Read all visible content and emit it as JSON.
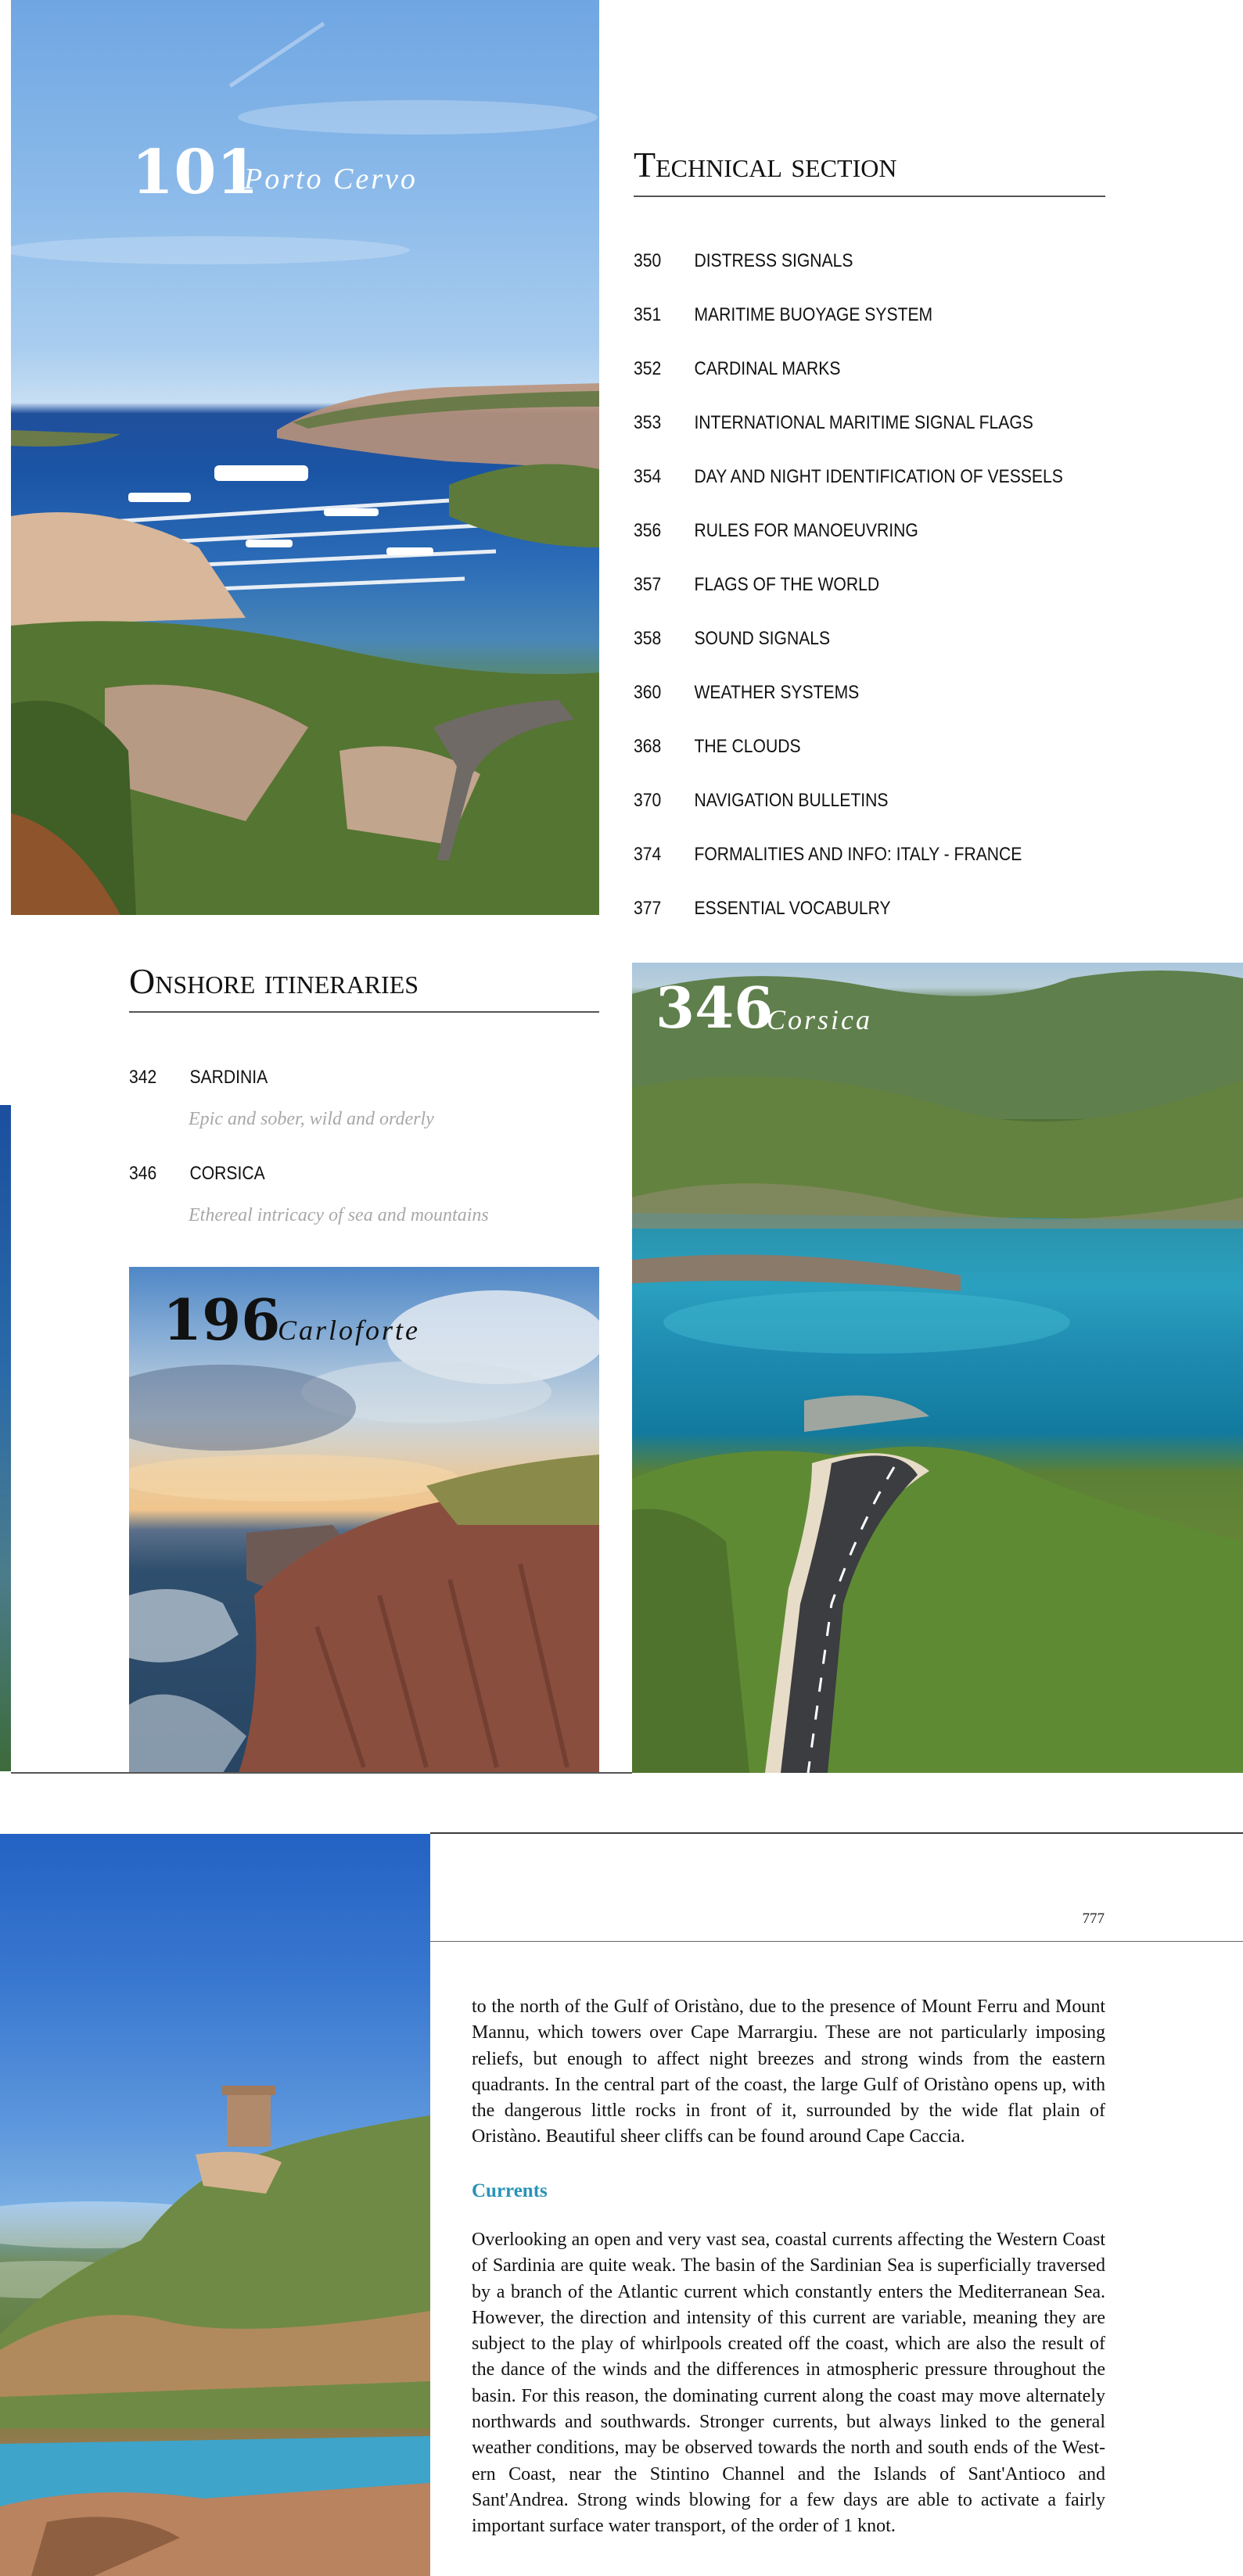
{
  "porto_cervo": {
    "number": "101",
    "place": "Porto Cervo"
  },
  "technical": {
    "title": "Technical section",
    "items": [
      {
        "num": "350",
        "label": "DISTRESS SIGNALS"
      },
      {
        "num": "351",
        "label": "MARITIME BUOYAGE SYSTEM"
      },
      {
        "num": "352",
        "label": "CARDINAL MARKS"
      },
      {
        "num": "353",
        "label": "INTERNATIONAL MARITIME SIGNAL FLAGS"
      },
      {
        "num": "354",
        "label": "DAY AND NIGHT IDENTIFICATION OF VESSELS"
      },
      {
        "num": "356",
        "label": "RULES FOR MANOEUVRING"
      },
      {
        "num": "357",
        "label": "FLAGS OF THE WORLD"
      },
      {
        "num": "358",
        "label": "SOUND SIGNALS"
      },
      {
        "num": "360",
        "label": "WEATHER SYSTEMS"
      },
      {
        "num": "368",
        "label": "THE CLOUDS"
      },
      {
        "num": "370",
        "label": "NAVIGATION BULLETINS"
      },
      {
        "num": "374",
        "label": "FORMALITIES AND INFO: ITALY - FRANCE"
      },
      {
        "num": "377",
        "label": "ESSENTIAL VOCABULRY"
      }
    ]
  },
  "onshore": {
    "title": "Onshore itineraries",
    "items": [
      {
        "num": "342",
        "label": "SARDINIA",
        "subtitle": "Epic and sober, wild and orderly"
      },
      {
        "num": "346",
        "label": "CORSICA",
        "subtitle": "Ethereal intricacy of sea and mountains"
      }
    ]
  },
  "corsica": {
    "number": "346",
    "place": "Corsica"
  },
  "carloforte": {
    "number": "196",
    "place": "Carloforte"
  },
  "page": {
    "number": "777",
    "intro": "to the north of the Gulf of Oristàno, due to the presence of Mount Ferru and Mount Mannu, which towers over Cape Marrargiu. These are not particularly imposing reliefs, but enough to affect night breezes and strong winds from the eastern quadrants. In the central part of the coast, the large Gulf of Oristàno opens up, with the dangerous little rocks in front of it, surrounded by the wide flat plain of Oristàno. Beautiful sheer cliffs can be found around Cape Caccia.",
    "heading": "Currents",
    "currents": "Overlooking an open and very vast sea, coastal currents affecting the West­ern Coast of Sardinia are quite weak. The basin of the Sardinian Sea is superficially traversed by a branch of the Atlantic current which constantly enters the Mediterranean Sea. However, the direction and intensity of this current are variable, meaning they are subject to the play of whirlpools crea­ted off the coast, which are also the result of the dance of the winds and the differences in atmospheric pressure throughout the basin. For this reason, the dominating current along the coast may move alternately northwards and southwards. Stronger currents, but always linked to the general weather conditions, may be observed towards the north and south ends of the West­ern Coast, near the Stintino Channel and the Islands of Sant'Antioco and Sant'Andrea. Strong winds blowing for a few days are able to activate a fairly important surface water transport, of the order of 1 knot."
  }
}
